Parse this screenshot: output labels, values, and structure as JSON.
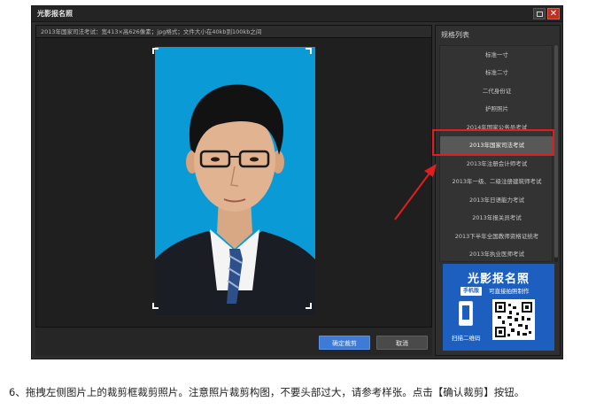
{
  "window": {
    "title": "光影报名照",
    "maximize_icon": "maximize-icon",
    "close_icon": "close-icon",
    "close_glyph": "✕"
  },
  "info_bar": {
    "text": "2013年国家司法考试：宽413×高626像素；jpg格式；文件大小在40kb到100kb之间"
  },
  "buttons": {
    "confirm_label": "确定裁剪",
    "cancel_label": "取消"
  },
  "spec_panel": {
    "header": "规格列表",
    "items": [
      {
        "label": "标准一寸",
        "selected": false
      },
      {
        "label": "标准二寸",
        "selected": false
      },
      {
        "label": "二代身份证",
        "selected": false
      },
      {
        "label": "护照照片",
        "selected": false
      },
      {
        "label": "2014年国家公务员考试",
        "selected": false
      },
      {
        "label": "2013年国家司法考试",
        "selected": true
      },
      {
        "label": "2013年注册会计师考试",
        "selected": false
      },
      {
        "label": "2013年一级、二级注册建筑师考试",
        "selected": false
      },
      {
        "label": "2013年日语能力考试",
        "selected": false
      },
      {
        "label": "2013年报关员考试",
        "selected": false
      },
      {
        "label": "2013下半年全国教师资格证统考",
        "selected": false
      },
      {
        "label": "2013年执业医师考试",
        "selected": false
      }
    ]
  },
  "ad": {
    "title": "光影报名照",
    "badge": "手机版",
    "subtitle": "可直接拍照制作",
    "scan_label": "扫描二维码"
  },
  "caption": {
    "text": "6、拖拽左侧图片上的裁剪框裁剪照片。注意照片裁剪构图，不要头部过大，请参考样张。点击【确认裁剪】按钮。"
  },
  "colors": {
    "photo_background": "#0a9bd6",
    "highlight_box": "#e01e1e",
    "arrow": "#e01e1e",
    "confirm_button": "#3d7bd6"
  }
}
